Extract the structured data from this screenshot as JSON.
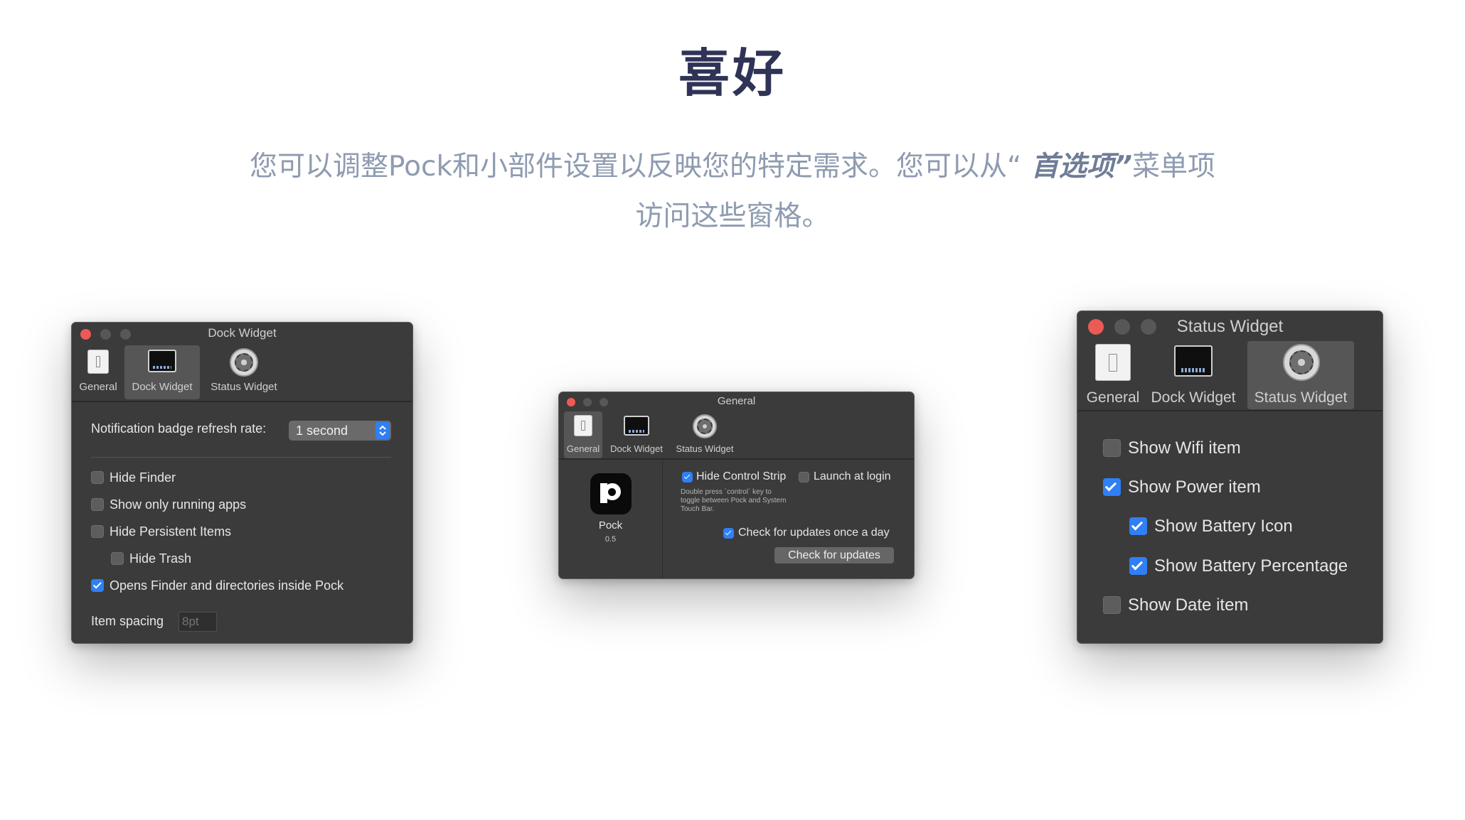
{
  "hero": {
    "title": "喜好",
    "desc_before": "您可以调整Pock和小部件设置以反映您的特定需求。您可以从“",
    "desc_emph": " 首选项”",
    "desc_after": "菜单项访问这些窗格。"
  },
  "tabs": {
    "general": "General",
    "dock": "Dock Widget",
    "status": "Status Widget"
  },
  "dock_window": {
    "title": "Dock Widget",
    "refresh_label": "Notification badge refresh rate:",
    "refresh_value": "1 second",
    "options": [
      {
        "label": "Hide Finder",
        "checked": false
      },
      {
        "label": "Show only running apps",
        "checked": false
      },
      {
        "label": "Hide Persistent Items",
        "checked": false
      },
      {
        "label": "Hide Trash",
        "checked": false
      },
      {
        "label": "Opens Finder and directories inside Pock",
        "checked": true
      }
    ],
    "spacing_label": "Item spacing",
    "spacing_placeholder": "8pt"
  },
  "general_window": {
    "title": "General",
    "app_name": "Pock",
    "app_version": "0.5",
    "hide_control_strip": {
      "label": "Hide Control Strip",
      "checked": true
    },
    "launch_at_login": {
      "label": "Launch at login",
      "checked": false
    },
    "hint": "Double press `control` key to toggle between Pock and System Touch Bar.",
    "check_updates_daily": {
      "label": "Check for updates once a day",
      "checked": true
    },
    "check_updates_button": "Check for updates"
  },
  "status_window": {
    "title": "Status Widget",
    "options": [
      {
        "label": "Show Wifi item",
        "checked": false
      },
      {
        "label": "Show Power item",
        "checked": true
      },
      {
        "label": "Show Battery Icon",
        "checked": true
      },
      {
        "label": "Show Battery Percentage",
        "checked": true
      },
      {
        "label": "Show Date item",
        "checked": false
      }
    ]
  },
  "colors": {
    "title": "#2f3356",
    "description": "#8e9bb0",
    "window_bg": "#3b3b3b",
    "checkbox_on": "#2f7ff6",
    "close_light": "#ec5a56"
  }
}
